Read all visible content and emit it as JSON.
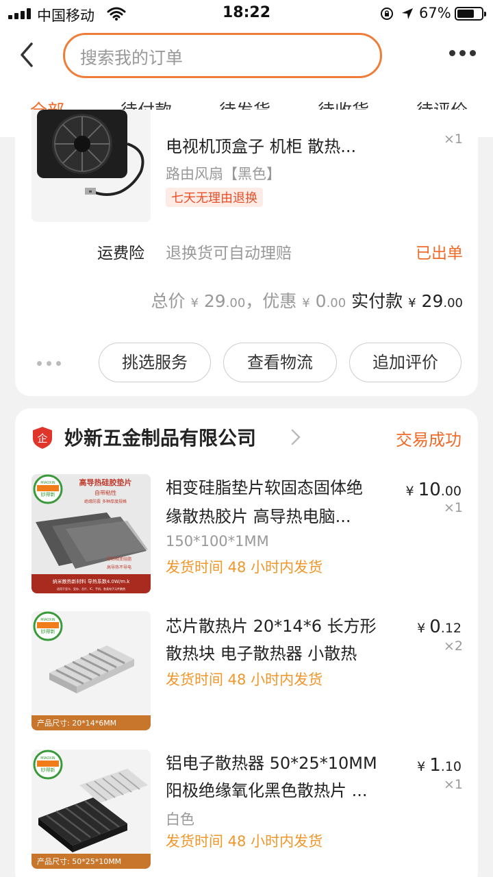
{
  "status_bar": {
    "carrier": "中国移动",
    "time": "18:22",
    "battery": "67%"
  },
  "header": {
    "search_placeholder": "搜索我的订单",
    "tabs": [
      {
        "label": "全部",
        "active": true
      },
      {
        "label": "待付款"
      },
      {
        "label": "待发货"
      },
      {
        "label": "待收货"
      },
      {
        "label": "待评价"
      }
    ]
  },
  "order1": {
    "item": {
      "title": "电视机顶盒子 机柜 散热...",
      "sku": "路由风扇【黑色】",
      "tag": "七天无理由退换",
      "qty": "×1"
    },
    "insurance": {
      "label": "运费险",
      "desc": "退换货可自动理赔",
      "status": "已出单"
    },
    "totals": {
      "total_label": "总价",
      "total_int": "29",
      "total_dec": ".00",
      "discount_label": "，优惠",
      "discount_int": "0",
      "discount_dec": ".00",
      "paid_label": "实付款",
      "paid_int": "29",
      "paid_dec": ".00",
      "currency": "¥"
    },
    "buttons": [
      "挑选服务",
      "查看物流",
      "追加评价"
    ]
  },
  "order2": {
    "shop_name": "妙新五金制品有限公司",
    "status": "交易成功",
    "items": [
      {
        "title_line1": "相变硅脂垫片软固态固体绝",
        "title_line2": "缘散热胶片 高导热电脑...",
        "sku": "150*100*1MM",
        "ship": "发货时间  48 小时内发货",
        "price_int": "10",
        "price_dec": ".00",
        "qty": "×1",
        "thumb": {
          "brand": "MIAOXIN",
          "brand_cn": "妙得新",
          "headline": "高导热硅胶垫片",
          "sub1": "自带粘性",
          "sub2": "绝缘防震  多种厚度规格",
          "note1": "导热相变硅脂",
          "note2": "高导热不导电",
          "footer": "纳米散热新材料 导热系数4.0W/m.k",
          "footer_small": "适用于显卡、显存、芯片、IC、手机、各类电子元件散热"
        }
      },
      {
        "title_line1": "芯片散热片 20*14*6 长方形",
        "title_line2": "散热块 电子散热器 小散热",
        "ship": "发货时间  48 小时内发货",
        "price_int": "0",
        "price_dec": ".12",
        "qty": "×2",
        "thumb": {
          "brand": "MIAOXIN",
          "brand_cn": "妙得新",
          "size_label": "产品尺寸: 20*14*6MM"
        }
      },
      {
        "title_line1": "铝电子散热器 50*25*10MM",
        "title_line2": "阳极绝缘氧化黑色散热片 ...",
        "sku": "白色",
        "ship": "发货时间  48 小时内发货",
        "price_int": "1",
        "price_dec": ".10",
        "qty": "×1",
        "thumb": {
          "brand": "MIAOXIN",
          "brand_cn": "妙得新",
          "size_label": "产品尺寸: 50*25*10MM"
        }
      }
    ]
  },
  "colors": {
    "accent": "#f06a28",
    "ship": "#f0962a",
    "tag_bg": "#fdece6",
    "page_bg": "#f2f2f2"
  },
  "icons": [
    "signal-icon",
    "wifi-icon",
    "lock-rotation-icon",
    "location-arrow-icon",
    "battery-icon",
    "back-chevron-icon",
    "more-dots-icon",
    "shop-badge-icon",
    "chevron-right-icon"
  ]
}
